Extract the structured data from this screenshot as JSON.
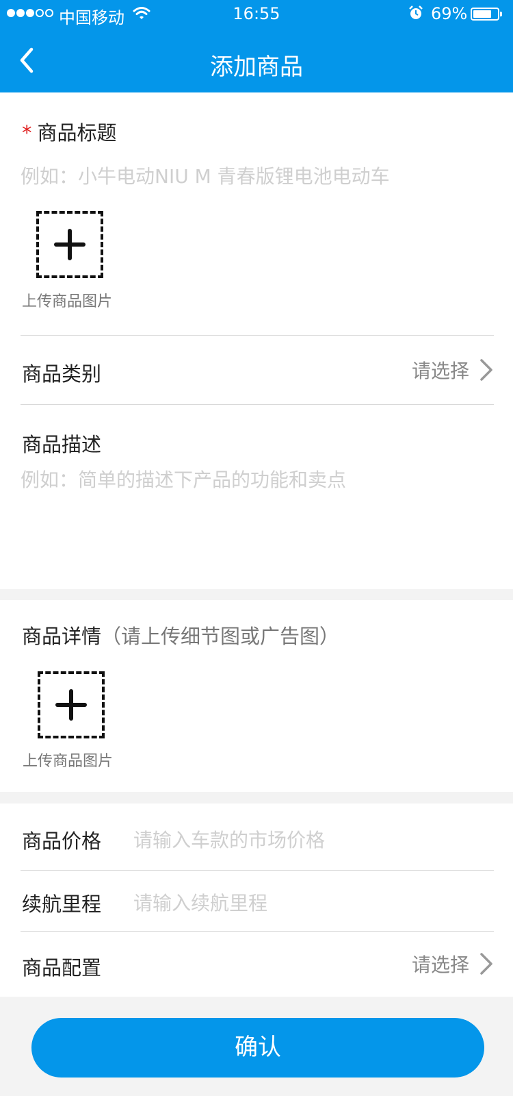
{
  "status_bar": {
    "carrier": "中国移动",
    "time": "16:55",
    "battery": "69%",
    "battery_level": 0.69,
    "icons": [
      "signal-dots-icon",
      "wifi-icon",
      "alarm-icon",
      "battery-icon"
    ]
  },
  "nav": {
    "title": "添加商品",
    "back_icon": "chevron-left-icon"
  },
  "form": {
    "title_field": {
      "required_mark": "*",
      "label": "商品标题",
      "placeholder": "例如：小牛电动NIU M 青春版锂电池电动车"
    },
    "main_images": {
      "caption": "上传商品图片"
    },
    "category": {
      "label": "商品类别",
      "value": "请选择"
    },
    "description": {
      "label": "商品描述",
      "placeholder": "例如：简单的描述下产品的功能和卖点"
    },
    "details": {
      "label": "商品详情",
      "hint": "（请上传细节图或广告图）",
      "caption": "上传商品图片"
    },
    "price": {
      "label": "商品价格",
      "placeholder": "请输入车款的市场价格"
    },
    "range": {
      "label": "续航里程",
      "placeholder": "请输入续航里程"
    },
    "config": {
      "label": "商品配置",
      "value": "请选择"
    }
  },
  "confirm_button": "确认",
  "colors": {
    "primary": "#0496ea",
    "required": "#e02020",
    "background": "#f3f3f3",
    "placeholder": "#cfcfcf"
  }
}
